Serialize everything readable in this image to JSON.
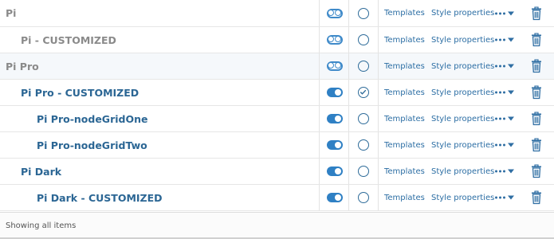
{
  "rows": [
    {
      "name": "Pi",
      "level": 0,
      "color": "grey",
      "enabled": false,
      "selected": false,
      "highlight": false
    },
    {
      "name": "Pi - CUSTOMIZED",
      "level": 1,
      "color": "grey",
      "enabled": false,
      "selected": false,
      "highlight": false
    },
    {
      "name": "Pi Pro",
      "level": 0,
      "color": "grey",
      "enabled": false,
      "selected": false,
      "highlight": true
    },
    {
      "name": "Pi Pro - CUSTOMIZED",
      "level": 1,
      "color": "blue",
      "enabled": true,
      "selected": true,
      "highlight": false
    },
    {
      "name": "Pi Pro-nodeGridOne",
      "level": 2,
      "color": "blue",
      "enabled": true,
      "selected": false,
      "highlight": false
    },
    {
      "name": "Pi Pro-nodeGridTwo",
      "level": 2,
      "color": "blue",
      "enabled": true,
      "selected": false,
      "highlight": false
    },
    {
      "name": "Pi Dark",
      "level": 1,
      "color": "blue",
      "enabled": true,
      "selected": false,
      "highlight": false
    },
    {
      "name": "Pi Dark - CUSTOMIZED",
      "level": 2,
      "color": "blue",
      "enabled": true,
      "selected": false,
      "highlight": false
    }
  ],
  "labels": {
    "templates": "Templates",
    "style_properties": "Style properties"
  },
  "icons": {
    "toggle": "toggle-switch-icon",
    "radio": "radio-circle-icon",
    "more": "more-dots-icon",
    "delete": "trash-icon"
  },
  "colors": {
    "accent": "#2f80c4",
    "grey_text": "#8a8a8a",
    "blue_text": "#2b6694"
  },
  "footer": {
    "status": "Showing all items"
  }
}
